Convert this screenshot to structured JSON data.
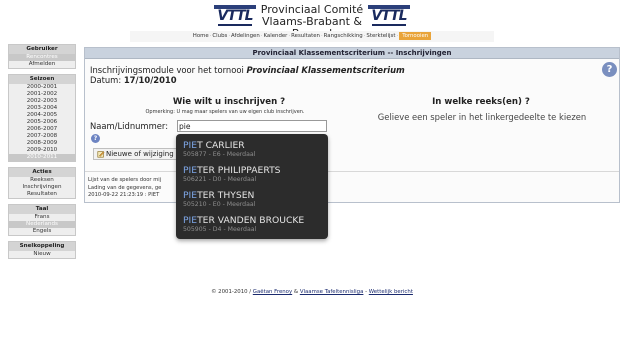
{
  "header": {
    "logo_left": "VTTL",
    "logo_right": "VTTL",
    "title_line1": "Provinciaal Comité",
    "title_line2": "Vlaams-Brabant & Brussel"
  },
  "nav": {
    "items": [
      "Home",
      "Clubs",
      "Afdelingen",
      "Kalender",
      "Resultaten",
      "Rangschikking",
      "Sterktelijst",
      "Tornooien"
    ],
    "separator": "·"
  },
  "sidebar": {
    "gebruiker": {
      "title": "Gebruiker",
      "items": [
        "Rencontres",
        "Afmelden"
      ]
    },
    "seizoen": {
      "title": "Seizoen",
      "items": [
        "2000-2001",
        "2001-2002",
        "2002-2003",
        "2003-2004",
        "2004-2005",
        "2005-2006",
        "2006-2007",
        "2007-2008",
        "2008-2009",
        "2009-2010",
        "2010-2011"
      ]
    },
    "acties": {
      "title": "Acties",
      "items": [
        "Reeksen",
        "Inschrijvingen",
        "Resultaten"
      ]
    },
    "taal": {
      "title": "Taal",
      "items": [
        "Frans",
        "Nederlands",
        "Engels"
      ]
    },
    "snelkoppeling": {
      "title": "Snelkoppeling",
      "items": [
        "Nieuw"
      ]
    }
  },
  "panel": {
    "title": "Provinciaal Klassementscriterium -- Inschrijvingen",
    "intro_prefix": "Inschrijvingsmodule voor het tornooi ",
    "intro_tournament": "Provinciaal Klassementscriterium",
    "date_label": "Datum: ",
    "date_value": "17/10/2010",
    "help_glyph": "?",
    "q1_title": "Wie wilt u inschrijven ?",
    "q1_note": "Opmerking: U mag maar spelers van uw eigen club inschrijven.",
    "naam_label": "Naam/Lidnummer:",
    "search_value": "pie",
    "new_button_label": "Nieuwe of wijziging",
    "q2_title": "In welke reeks(en) ?",
    "q2_subtitle": "Gelieve een speler in het linkergedeelte te kiezen",
    "list_text": "Lijst van de spelers door mij",
    "loading_text": "Lading van de gegevens, ge",
    "log_text": "2010-09-22 21:23:19 : PIET"
  },
  "suggestions": [
    {
      "match": "PIE",
      "rest": "T CARLIER",
      "sub": "505877 - E6 - Meerdaal"
    },
    {
      "match": "PIE",
      "rest": "TER PHILIPPAERTS",
      "sub": "506221 - D0 - Meerdaal"
    },
    {
      "match": "PIE",
      "rest": "TER THYSEN",
      "sub": "505210 - E0 - Meerdaal"
    },
    {
      "match": "PIE",
      "rest": "TER VANDEN BROUCKE",
      "sub": "505905 - D4 - Meerdaal"
    }
  ],
  "footer": {
    "prefix": "© 2001-2010 / ",
    "author": "Gaëtan Frenoy",
    "amp": " & ",
    "org": "Vlaamse Tafeltennisliga",
    "dash": " - ",
    "legal": "Wettelijk bericht"
  },
  "colors": {
    "nav_active": "#e9a43a",
    "panel_header": "#c9d2de",
    "dropdown_bg": "#2c2c2c",
    "match_highlight": "#7ea7e8"
  }
}
